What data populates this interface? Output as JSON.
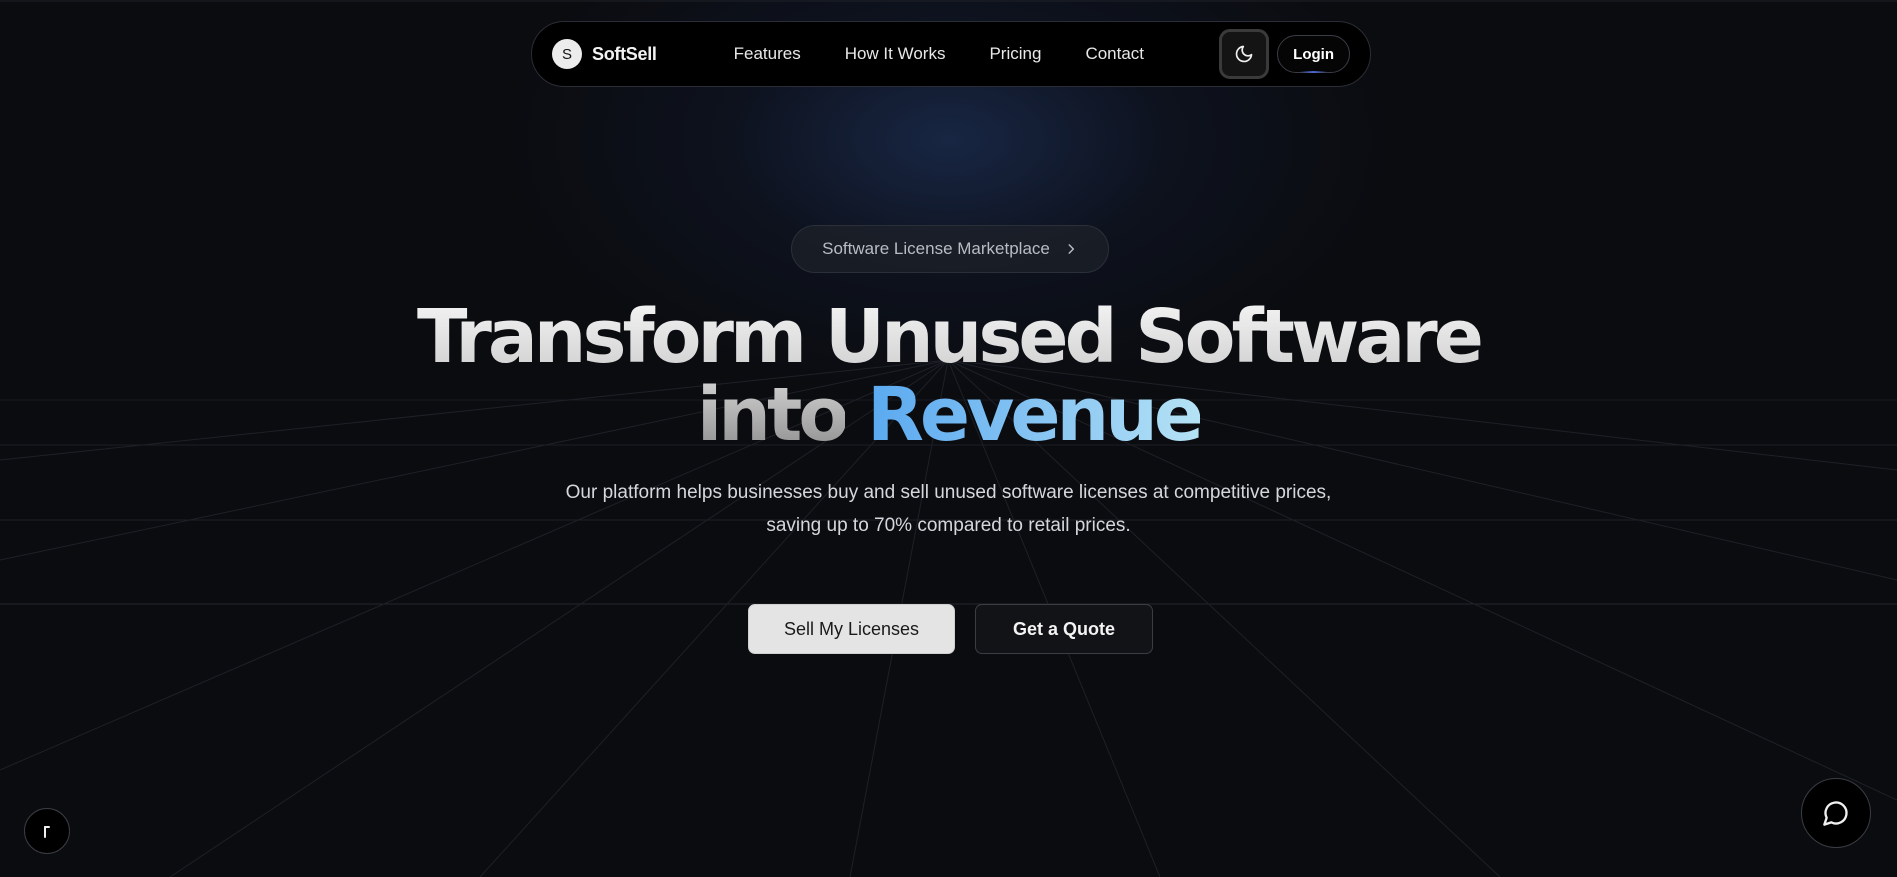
{
  "brand": {
    "mark": "S",
    "name": "SoftSell"
  },
  "nav": {
    "links": [
      "Features",
      "How It Works",
      "Pricing",
      "Contact"
    ],
    "login_label": "Login",
    "theme_icon": "moon-icon"
  },
  "hero": {
    "badge_label": "Software License Marketplace",
    "badge_icon": "chevron-right-icon",
    "headline_line1": "Transform Unused Software",
    "headline_line2_plain": "into",
    "headline_line2_accent": "Revenue",
    "subtitle_line1": "Our platform helps businesses buy and sell unused software licenses at competitive prices,",
    "subtitle_line2": "saving up to 70% compared to retail prices.",
    "primary_cta": "Sell My Licenses",
    "secondary_cta": "Get a Quote"
  },
  "floating": {
    "chat_icon": "chat-bubble-icon",
    "corner_icon": "cursor-icon"
  },
  "colors": {
    "background": "#0b0c10",
    "accent_gradient_start": "#5aa9f0",
    "accent_gradient_end": "#b5e3f5"
  }
}
